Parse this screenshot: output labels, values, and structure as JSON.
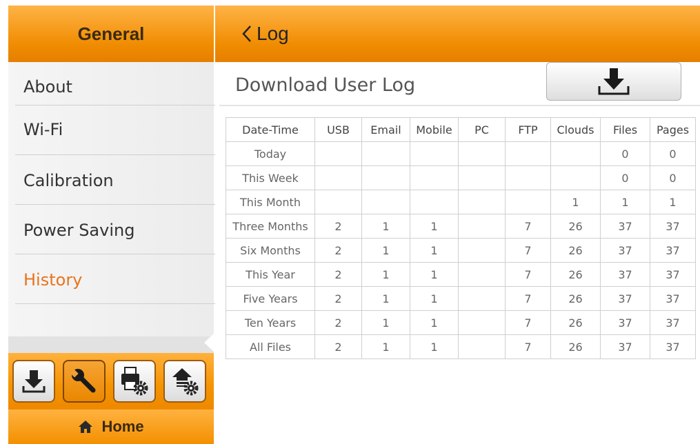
{
  "left_header": {
    "title": "General"
  },
  "sidebar": {
    "items": [
      {
        "label": "About",
        "active": false
      },
      {
        "label": "Wi-Fi",
        "active": false
      },
      {
        "label": "Calibration",
        "active": false
      },
      {
        "label": "Power Saving",
        "active": false
      },
      {
        "label": "History",
        "active": true
      }
    ]
  },
  "toolbar": {
    "buttons": [
      {
        "icon": "download-icon",
        "active": false
      },
      {
        "icon": "wrench-icon",
        "active": true
      },
      {
        "icon": "printer-settings-icon",
        "active": false
      },
      {
        "icon": "upload-settings-icon",
        "active": false
      }
    ]
  },
  "home": {
    "label": "Home",
    "icon": "home-icon"
  },
  "header": {
    "back_label": "Log"
  },
  "section": {
    "title": "Download User Log",
    "button_icon": "download-icon"
  },
  "colors": {
    "accent": "#f08c00",
    "active_text": "#e8741a"
  },
  "table": {
    "headers": [
      "Date-Time",
      "USB",
      "Email",
      "Mobile",
      "PC",
      "FTP",
      "Clouds",
      "Files",
      "Pages"
    ],
    "rows": [
      [
        "Today",
        "",
        "",
        "",
        "",
        "",
        "",
        "0",
        "0"
      ],
      [
        "This Week",
        "",
        "",
        "",
        "",
        "",
        "",
        "0",
        "0"
      ],
      [
        "This Month",
        "",
        "",
        "",
        "",
        "",
        "1",
        "1",
        "1"
      ],
      [
        "Three Months",
        "2",
        "1",
        "1",
        "",
        "7",
        "26",
        "37",
        "37"
      ],
      [
        "Six Months",
        "2",
        "1",
        "1",
        "",
        "7",
        "26",
        "37",
        "37"
      ],
      [
        "This Year",
        "2",
        "1",
        "1",
        "",
        "7",
        "26",
        "37",
        "37"
      ],
      [
        "Five Years",
        "2",
        "1",
        "1",
        "",
        "7",
        "26",
        "37",
        "37"
      ],
      [
        "Ten Years",
        "2",
        "1",
        "1",
        "",
        "7",
        "26",
        "37",
        "37"
      ],
      [
        "All Files",
        "2",
        "1",
        "1",
        "",
        "7",
        "26",
        "37",
        "37"
      ]
    ]
  }
}
